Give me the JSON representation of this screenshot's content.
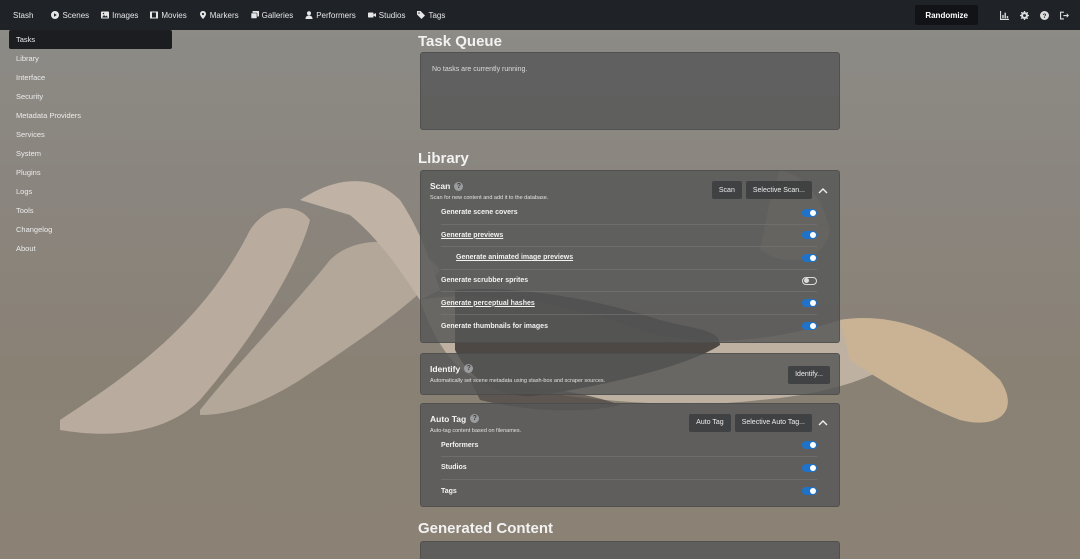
{
  "navbar": {
    "brand": "Stash",
    "items": [
      {
        "label": "Scenes",
        "icon": "play-circle-icon"
      },
      {
        "label": "Images",
        "icon": "image-icon"
      },
      {
        "label": "Movies",
        "icon": "film-icon"
      },
      {
        "label": "Markers",
        "icon": "map-marker-icon"
      },
      {
        "label": "Galleries",
        "icon": "images-icon"
      },
      {
        "label": "Performers",
        "icon": "user-icon"
      },
      {
        "label": "Studios",
        "icon": "video-icon"
      },
      {
        "label": "Tags",
        "icon": "tag-icon"
      }
    ],
    "randomize_label": "Randomize",
    "right_icons": [
      "chart-icon",
      "gear-icon",
      "help-icon",
      "logout-icon"
    ]
  },
  "sidebar": {
    "items": [
      {
        "label": "Tasks",
        "active": true
      },
      {
        "label": "Library"
      },
      {
        "label": "Interface"
      },
      {
        "label": "Security"
      },
      {
        "label": "Metadata Providers"
      },
      {
        "label": "Services"
      },
      {
        "label": "System"
      },
      {
        "label": "Plugins"
      },
      {
        "label": "Logs"
      },
      {
        "label": "Tools"
      },
      {
        "label": "Changelog"
      },
      {
        "label": "About"
      }
    ]
  },
  "main": {
    "task_queue": {
      "title": "Task Queue",
      "empty_text": "No tasks are currently running."
    },
    "library": {
      "title": "Library",
      "scan": {
        "title": "Scan",
        "description": "Scan for new content and add it to the database.",
        "scan_button": "Scan",
        "selective_button": "Selective Scan...",
        "options": [
          {
            "label": "Generate scene covers",
            "enabled": true
          },
          {
            "label": "Generate previews",
            "enabled": true
          },
          {
            "label": "Generate animated image previews",
            "enabled": true
          },
          {
            "label": "Generate scrubber sprites",
            "enabled": false
          },
          {
            "label": "Generate perceptual hashes",
            "enabled": true
          },
          {
            "label": "Generate thumbnails for images",
            "enabled": true
          }
        ]
      },
      "identify": {
        "title": "Identify",
        "description": "Automatically set scene metadata using stash-box and scraper sources.",
        "button": "Identify..."
      },
      "auto_tag": {
        "title": "Auto Tag",
        "description": "Auto-tag content based on filenames.",
        "auto_tag_button": "Auto Tag",
        "selective_button": "Selective Auto Tag...",
        "options": [
          {
            "label": "Performers",
            "enabled": true
          },
          {
            "label": "Studios",
            "enabled": true
          },
          {
            "label": "Tags",
            "enabled": true
          }
        ]
      }
    },
    "generated_content": {
      "title": "Generated Content"
    }
  },
  "colors": {
    "navbar_bg": "#1f2227",
    "toggle_on": "#1f72c9",
    "card_bg": "#555757"
  }
}
